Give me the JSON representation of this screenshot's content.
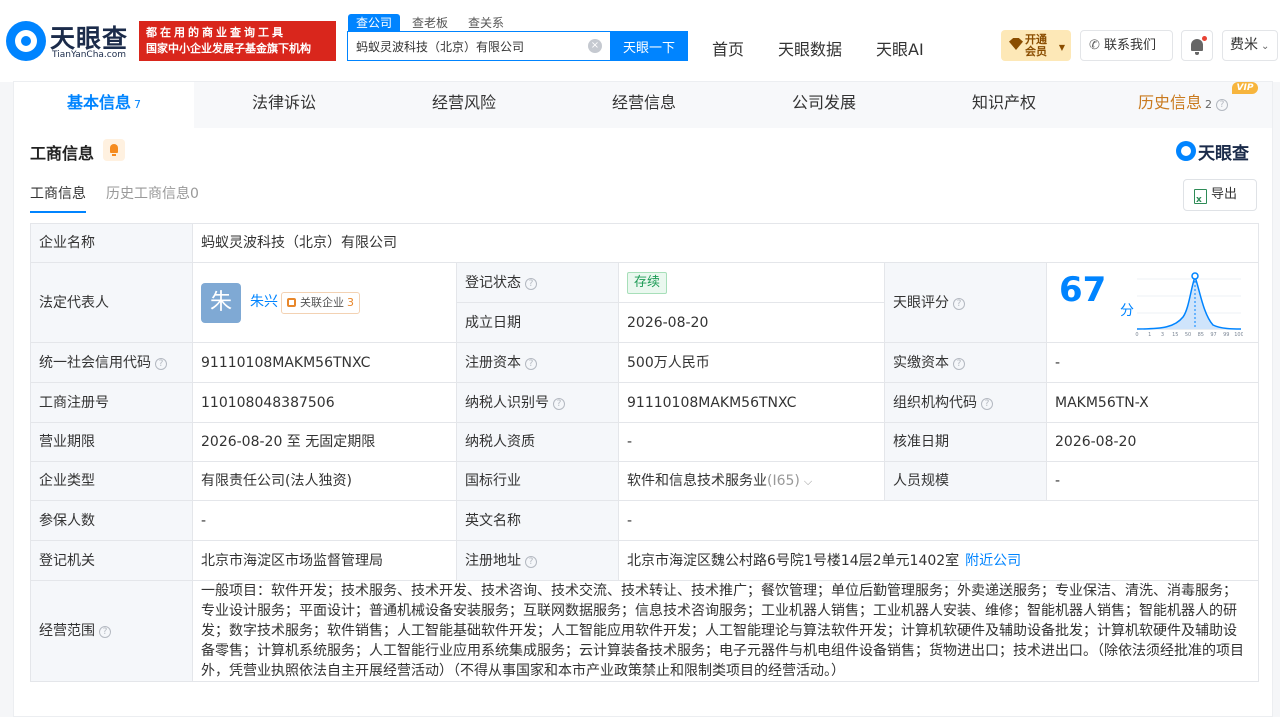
{
  "header": {
    "logo_cn": "天眼查",
    "logo_en": "TianYanCha.com",
    "slogan_line1": "都在用的商业查询工具",
    "slogan_line2": "国家中小企业发展子基金旗下机构",
    "search_tabs": [
      "查公司",
      "查老板",
      "查关系"
    ],
    "search_value": "蚂蚁灵波科技（北京）有限公司",
    "search_button": "天眼一下",
    "nav": [
      "首页",
      "天眼数据",
      "天眼AI"
    ],
    "vip_line1": "开通",
    "vip_line2": "会员",
    "contact": "联系我们",
    "user": "费米"
  },
  "tabs": [
    {
      "label": "基本信息",
      "count": "7"
    },
    {
      "label": "法律诉讼",
      "count": ""
    },
    {
      "label": "经营风险",
      "count": ""
    },
    {
      "label": "经营信息",
      "count": ""
    },
    {
      "label": "公司发展",
      "count": ""
    },
    {
      "label": "知识产权",
      "count": ""
    },
    {
      "label": "历史信息",
      "count": "2",
      "badge": "VIP"
    }
  ],
  "section": {
    "title": "工商信息",
    "brand": "天眼查",
    "subtabs": [
      "工商信息",
      "历史工商信息0"
    ],
    "export": "导出"
  },
  "info": {
    "company_name_label": "企业名称",
    "company_name": "蚂蚁灵波科技（北京）有限公司",
    "legal_rep_label": "法定代表人",
    "legal_rep_avatar": "朱",
    "legal_rep_name": "朱兴",
    "related_label": "关联企业",
    "related_count": "3",
    "status_label": "登记状态",
    "status": "存续",
    "est_date_label": "成立日期",
    "est_date": "2026-08-20",
    "score_label": "天眼评分",
    "score": "67",
    "score_unit": "分",
    "score_axis": [
      "0",
      "1",
      "3",
      "15",
      "50",
      "85",
      "97",
      "99",
      "100"
    ],
    "credit_code_label": "统一社会信用代码",
    "credit_code": "91110108MAKM56TNXC",
    "reg_capital_label": "注册资本",
    "reg_capital": "500万人民币",
    "paid_capital_label": "实缴资本",
    "paid_capital": "-",
    "reg_no_label": "工商注册号",
    "reg_no": "110108048387506",
    "taxpayer_id_label": "纳税人识别号",
    "taxpayer_id": "91110108MAKM56TNXC",
    "org_code_label": "组织机构代码",
    "org_code": "MAKM56TN-X",
    "term_label": "营业期限",
    "term": "2026-08-20 至 无固定期限",
    "taxpayer_qual_label": "纳税人资质",
    "taxpayer_qual": "-",
    "approve_date_label": "核准日期",
    "approve_date": "2026-08-20",
    "type_label": "企业类型",
    "type": "有限责任公司(法人独资)",
    "industry_label": "国标行业",
    "industry": "软件和信息技术服务业",
    "industry_code": "(I65)",
    "staff_label": "人员规模",
    "staff": "-",
    "insured_label": "参保人数",
    "insured": "-",
    "en_name_label": "英文名称",
    "en_name": "-",
    "authority_label": "登记机关",
    "authority": "北京市海淀区市场监督管理局",
    "address_label": "注册地址",
    "address": "北京市海淀区魏公村路6号院1号楼14层2单元1402室",
    "nearby": "附近公司",
    "scope_label": "经营范围",
    "scope": "一般项目：软件开发；技术服务、技术开发、技术咨询、技术交流、技术转让、技术推广；餐饮管理；单位后勤管理服务；外卖递送服务；专业保洁、清洗、消毒服务；专业设计服务；平面设计；普通机械设备安装服务；互联网数据服务；信息技术咨询服务；工业机器人销售；工业机器人安装、维修；智能机器人销售；智能机器人的研发；数字技术服务；软件销售；人工智能基础软件开发；人工智能应用软件开发；人工智能理论与算法软件开发；计算机软硬件及辅助设备批发；计算机软硬件及辅助设备零售；计算机系统服务；人工智能行业应用系统集成服务；云计算装备技术服务；电子元器件与机电组件设备销售；货物进出口；技术进出口。（除依法须经批准的项目外，凭营业执照依法自主开展经营活动）（不得从事国家和本市产业政策禁止和限制类项目的经营活动。）"
  },
  "colors": {
    "accent": "#0084ff",
    "slogan_bg": "#d9261c",
    "status_green": "#1d9b55",
    "history_tab": "#c97a1e"
  }
}
